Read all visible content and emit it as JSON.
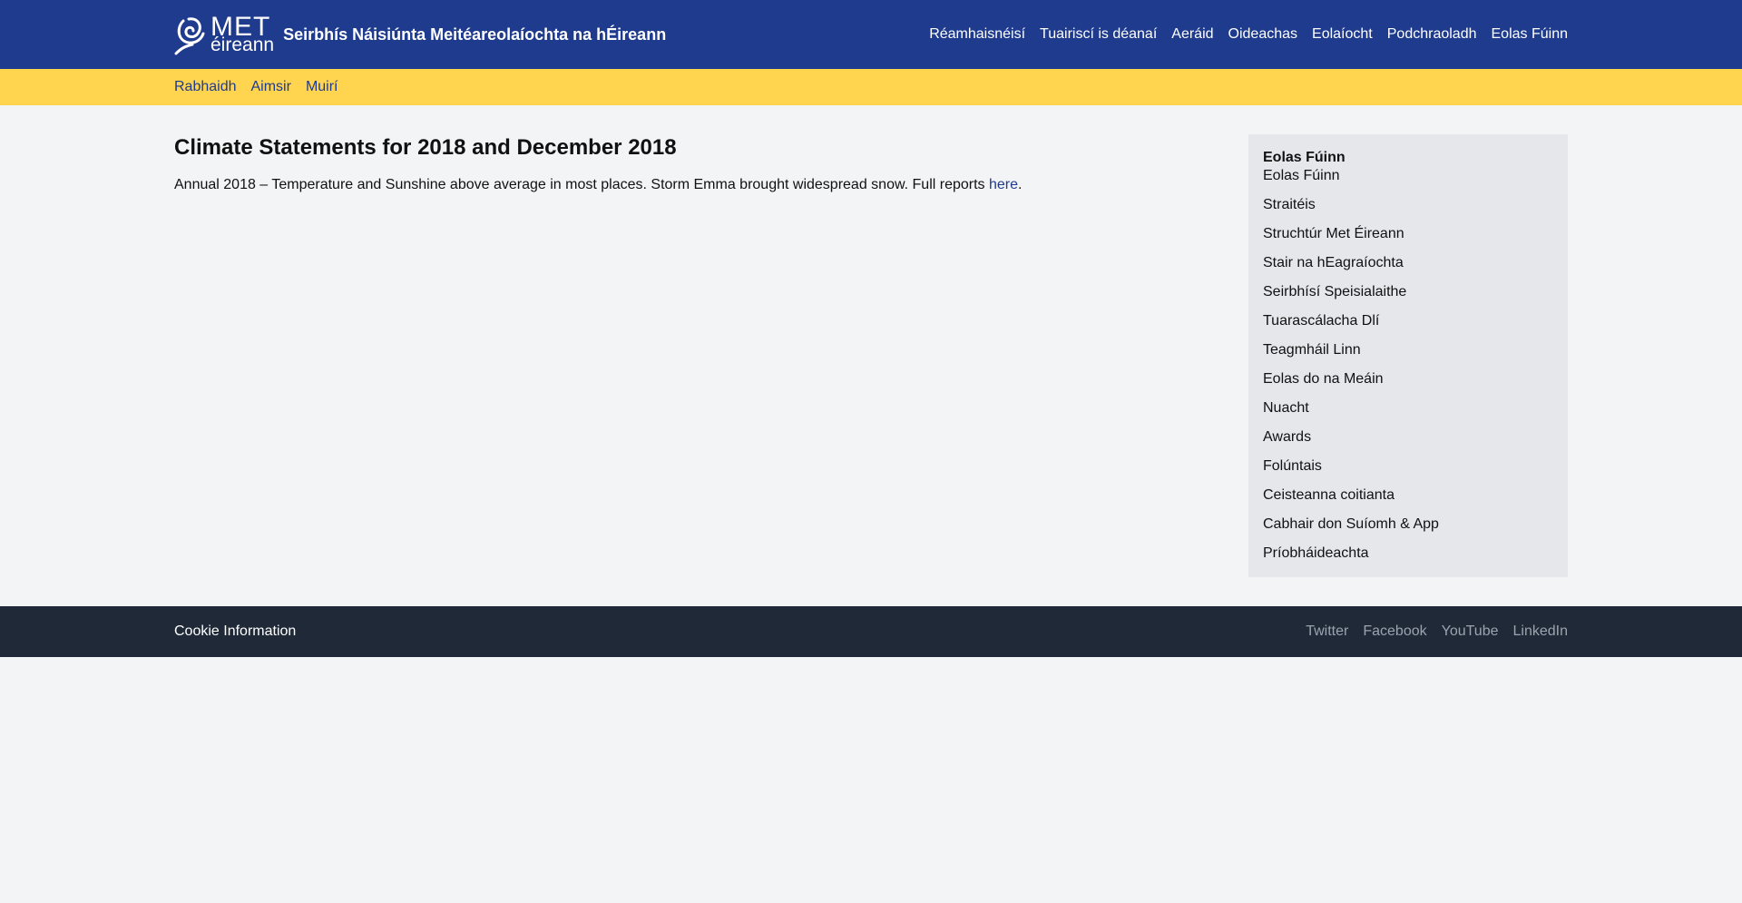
{
  "header": {
    "logo_met": "MET",
    "logo_eireann": "éireann",
    "site_title": "Seirbhís Náisiúnta Meitéareolaíochta na hÉireann",
    "nav": [
      "Réamhaisnéisí",
      "Tuairiscí is déanaí",
      "Aeráid",
      "Oideachas",
      "Eolaíocht",
      "Podchraoladh",
      "Eolas Fúinn"
    ]
  },
  "subnav": [
    "Rabhaidh",
    "Aimsir",
    "Muirí"
  ],
  "main": {
    "title": "Climate Statements for 2018 and December 2018",
    "intro_text": "Annual 2018 – Temperature and Sunshine above average in most places. Storm Emma brought widespread snow. Full reports ",
    "intro_link": "here",
    "intro_end": "."
  },
  "sidebar": {
    "heading": "Eolas Fúinn",
    "items": [
      "Eolas Fúinn",
      "Straitéis",
      "Struchtúr Met Éireann",
      "Stair na hEagraíochta",
      "Seirbhísí Speisialaithe",
      "Tuarascálacha Dlí",
      "Teagmháil Linn",
      "Eolas do na Meáin",
      "Nuacht",
      "Awards",
      "Folúntais",
      "Ceisteanna coitianta",
      "Cabhair don Suíomh & App",
      "Príobháideachta"
    ]
  },
  "footer": {
    "cookie": "Cookie Information",
    "social": [
      "Twitter",
      "Facebook",
      "YouTube",
      "LinkedIn"
    ]
  },
  "colors": {
    "header_bg": "#1f3b8e",
    "subnav_bg": "#ffd54f",
    "sidebar_bg": "#e5e7eb",
    "footer_bg": "#1f2937",
    "page_bg": "#f3f4f6"
  }
}
